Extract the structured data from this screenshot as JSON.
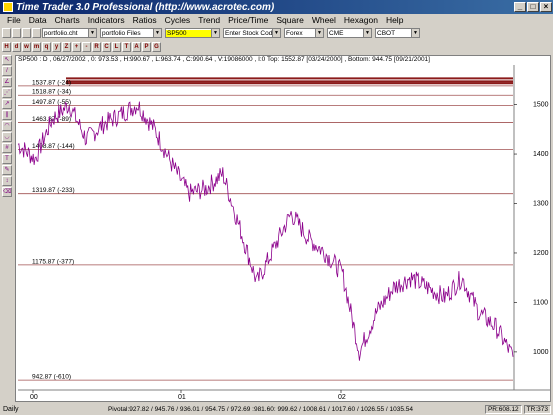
{
  "window": {
    "title": "Time Trader 3.0 Professional (http://www.acrotec.com)"
  },
  "menu": [
    "File",
    "Data",
    "Charts",
    "Indicators",
    "Ratios",
    "Cycles",
    "Trend",
    "Price/Time",
    "Square",
    "Wheel",
    "Hexagon",
    "Help"
  ],
  "toolbar": {
    "portfolio_file": "portfolio.cht",
    "portfolio_files": "portfolio Files",
    "symbol": "SP500",
    "stock_code_placeholder": "Enter Stock Code",
    "market_1": "Forex",
    "market_2": "CME",
    "market_3": "CBOT"
  },
  "toolbar2_buttons": [
    "H",
    "d",
    "w",
    "m",
    "q",
    "y",
    "Z",
    "+",
    "-",
    "R",
    "C",
    "L",
    "T",
    "A",
    "P",
    "G"
  ],
  "info_bar": "SP500 : D , 06/27/2002 , 0: 973.53 , H:990.67 , L:963.74 , C:990.64 , V:19086000 , I:0      Top: 1552.87 [03/24/2000] , Bottom: 944.75 [09/21/2001]",
  "status": {
    "period": "Daily",
    "pivots": "Pivotal:927.82 / 945.76 / 936.01 / 954.75 / 972.69 :981.60: 999.62 / 1008.61 / 1017.60 / 1026.55 / 1035.54",
    "pr": "PR:608.12",
    "tr": "TR:373"
  },
  "colors": {
    "price_line": "#8b008b",
    "level_line": "#a05050",
    "top_band": "#8b1a1a"
  },
  "chart_data": {
    "type": "line",
    "series_color": "#8b008b",
    "y_ticks": [
      1500,
      1400,
      1300,
      1200,
      1100,
      1000
    ],
    "x_ticks": [
      "00",
      "01",
      "02"
    ],
    "ylim": [
      925,
      1580
    ],
    "levels": [
      {
        "price": 1552.87,
        "label": ""
      },
      {
        "price": 1547,
        "label": ""
      },
      {
        "price": 1543,
        "label": ""
      },
      {
        "price": 1537.87,
        "label": "1537.87  (-24)"
      },
      {
        "price": 1518.87,
        "label": "1518.87  (-34)"
      },
      {
        "price": 1497.87,
        "label": "1497.87  (-55)"
      },
      {
        "price": 1463.87,
        "label": "1463.87  (-89)"
      },
      {
        "price": 1408.87,
        "label": "1408.87  (-144)"
      },
      {
        "price": 1319.87,
        "label": "1319.87  (-233)"
      },
      {
        "price": 1175.87,
        "label": "1175.87  (-377)"
      },
      {
        "price": 942.87,
        "label": "942.87  (-610)"
      }
    ],
    "x": [
      "2000-01",
      "2000-02",
      "2000-03",
      "2000-04",
      "2000-05",
      "2000-06",
      "2000-07",
      "2000-08",
      "2000-09",
      "2000-10",
      "2000-11",
      "2000-12",
      "2001-01",
      "2001-02",
      "2001-03",
      "2001-04",
      "2001-05",
      "2001-06",
      "2001-07",
      "2001-08",
      "2001-09",
      "2001-10",
      "2001-11",
      "2001-12",
      "2002-01",
      "2002-02",
      "2002-03",
      "2002-04",
      "2002-05",
      "2002-06"
    ],
    "close": [
      1420,
      1390,
      1470,
      1500,
      1430,
      1460,
      1480,
      1500,
      1450,
      1380,
      1320,
      1330,
      1360,
      1250,
      1140,
      1210,
      1280,
      1230,
      1200,
      1160,
      1000,
      1080,
      1130,
      1150,
      1130,
      1110,
      1150,
      1080,
      1050,
      990
    ]
  }
}
